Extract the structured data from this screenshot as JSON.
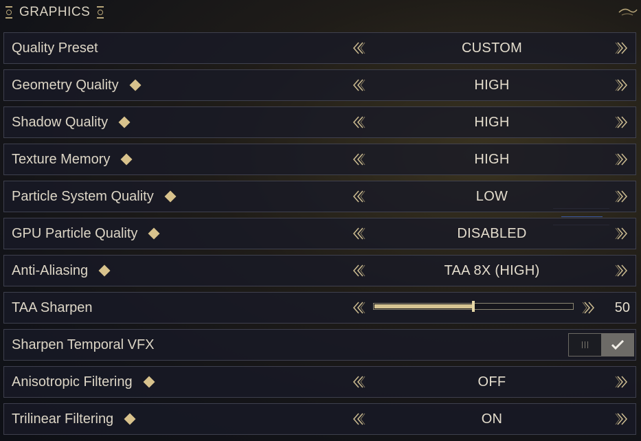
{
  "header": {
    "title": "GRAPHICS"
  },
  "colors": {
    "accent": "#d8c28c",
    "row_bg": "#181a26",
    "text": "#ddd6c6"
  },
  "rows": [
    {
      "label": "Quality Preset",
      "has_marker": false,
      "control": "selector",
      "value": "CUSTOM"
    },
    {
      "label": "Geometry Quality",
      "has_marker": true,
      "control": "selector",
      "value": "HIGH"
    },
    {
      "label": "Shadow Quality",
      "has_marker": true,
      "control": "selector",
      "value": "HIGH"
    },
    {
      "label": "Texture Memory",
      "has_marker": true,
      "control": "selector",
      "value": "HIGH"
    },
    {
      "label": "Particle System Quality",
      "has_marker": true,
      "control": "selector",
      "value": "LOW"
    },
    {
      "label": "GPU Particle Quality",
      "has_marker": true,
      "control": "selector",
      "value": "DISABLED"
    },
    {
      "label": "Anti-Aliasing",
      "has_marker": true,
      "control": "selector",
      "value": "TAA 8X (HIGH)"
    },
    {
      "label": "TAA Sharpen",
      "has_marker": false,
      "control": "slider",
      "value": "50",
      "fill_percent": 50
    },
    {
      "label": "Sharpen Temporal VFX",
      "has_marker": false,
      "control": "toggle",
      "state": "on"
    },
    {
      "label": "Anisotropic Filtering",
      "has_marker": true,
      "control": "selector",
      "value": "OFF"
    },
    {
      "label": "Trilinear Filtering",
      "has_marker": true,
      "control": "selector",
      "value": "ON"
    }
  ],
  "icons": {
    "left_arrow": "double-chevron-left-icon",
    "right_arrow": "double-chevron-right-icon",
    "marker": "diamond-icon",
    "check": "checkmark-icon"
  }
}
